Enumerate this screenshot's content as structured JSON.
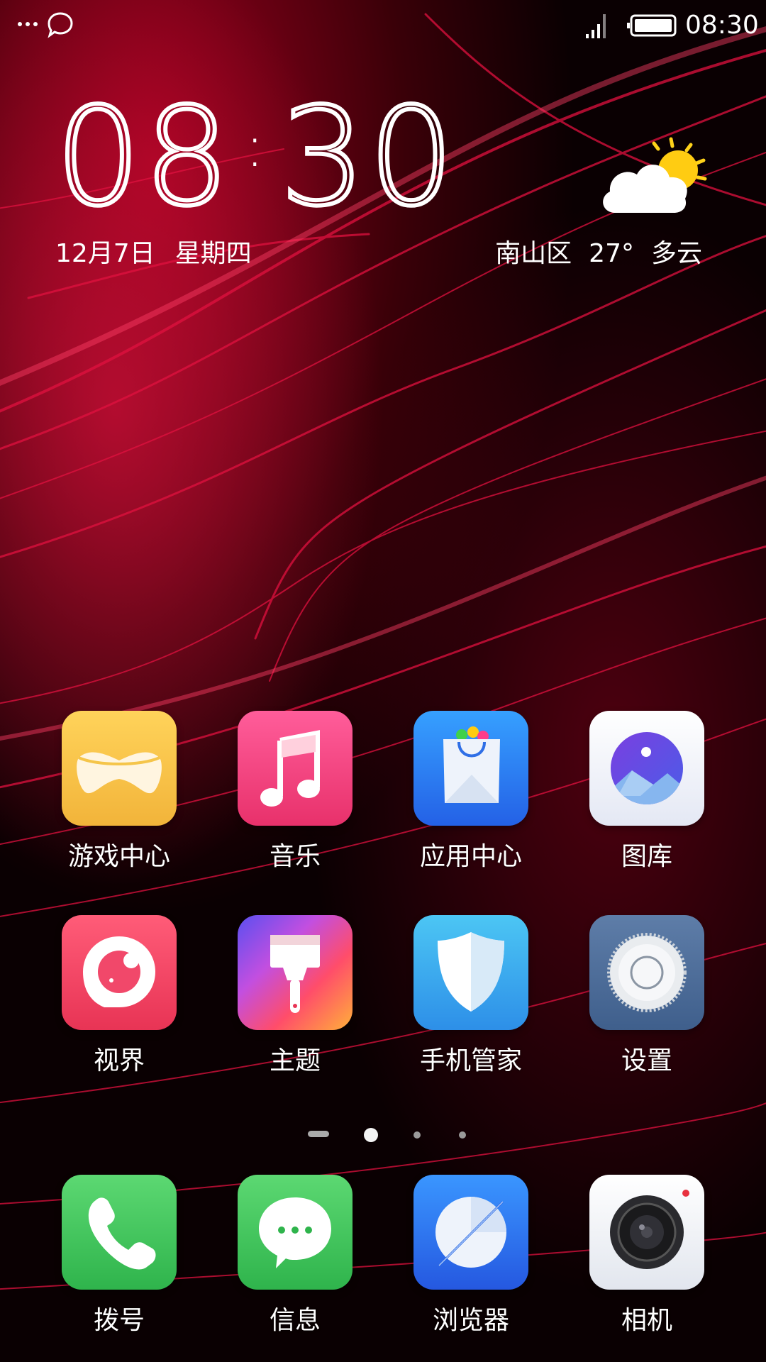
{
  "status_bar": {
    "time": "08:30",
    "icons": [
      "more-dots-icon",
      "message-bubble-icon",
      "signal-icon",
      "battery-icon"
    ]
  },
  "clock_widget": {
    "hours": "08",
    "minutes": "30",
    "date": "12月7日",
    "weekday": "星期四"
  },
  "weather_widget": {
    "location": "南山区",
    "temperature": "27°",
    "condition": "多云",
    "icon": "partly-cloudy-icon"
  },
  "apps": [
    {
      "label": "游戏中心",
      "icon": "game-controller-icon"
    },
    {
      "label": "音乐",
      "icon": "music-note-icon"
    },
    {
      "label": "应用中心",
      "icon": "shopping-bag-icon"
    },
    {
      "label": "图库",
      "icon": "gallery-icon"
    },
    {
      "label": "视界",
      "icon": "video-bubble-icon"
    },
    {
      "label": "主题",
      "icon": "paint-brush-icon"
    },
    {
      "label": "手机管家",
      "icon": "shield-icon"
    },
    {
      "label": "设置",
      "icon": "gear-icon"
    }
  ],
  "page_indicator": {
    "pages": 4,
    "current": 2
  },
  "dock": [
    {
      "label": "拨号",
      "icon": "phone-icon"
    },
    {
      "label": "信息",
      "icon": "chat-bubble-icon"
    },
    {
      "label": "浏览器",
      "icon": "compass-icon"
    },
    {
      "label": "相机",
      "icon": "camera-icon"
    }
  ],
  "colors": {
    "wallpaper_base": "#0a0002",
    "wallpaper_accent": "#e0113f"
  }
}
